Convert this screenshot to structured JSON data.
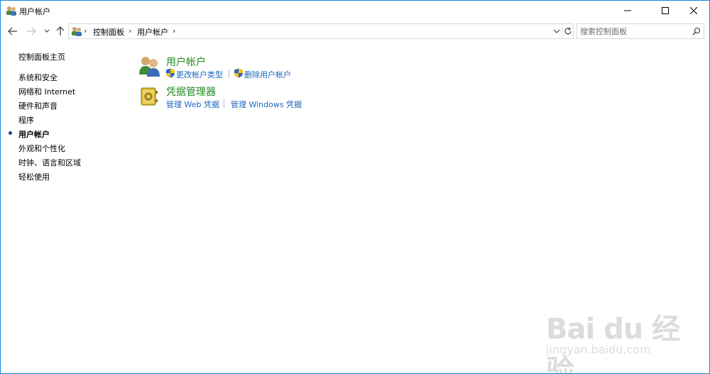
{
  "window": {
    "title": "用户帐户",
    "minimize": "minimize",
    "maximize": "maximize",
    "close": "close"
  },
  "navigation": {
    "breadcrumbs": [
      "控制面板",
      "用户帐户"
    ],
    "search_placeholder": "搜索控制面板"
  },
  "left_pane": {
    "home": "控制面板主页",
    "items": [
      {
        "label": "系统和安全",
        "current": false
      },
      {
        "label": "网络和 Internet",
        "current": false
      },
      {
        "label": "硬件和声音",
        "current": false
      },
      {
        "label": "程序",
        "current": false
      },
      {
        "label": "用户帐户",
        "current": true
      },
      {
        "label": "外观和个性化",
        "current": false
      },
      {
        "label": "时钟、语言和区域",
        "current": false
      },
      {
        "label": "轻松使用",
        "current": false
      }
    ]
  },
  "main": {
    "categories": [
      {
        "title": "用户帐户",
        "icon": "users-icon",
        "links": [
          "更改帐户类型",
          "删除用户帐户"
        ]
      },
      {
        "title": "凭据管理器",
        "icon": "credential-vault-icon",
        "links": [
          "管理 Web 凭据",
          "管理 Windows 凭据"
        ]
      }
    ]
  },
  "watermark": {
    "brand": "Bai du 经验",
    "url": "jingyan.baidu.com"
  },
  "colors": {
    "link": "#1a66c2",
    "category_title": "#1e8a1e",
    "window_border": "#1883d7"
  }
}
